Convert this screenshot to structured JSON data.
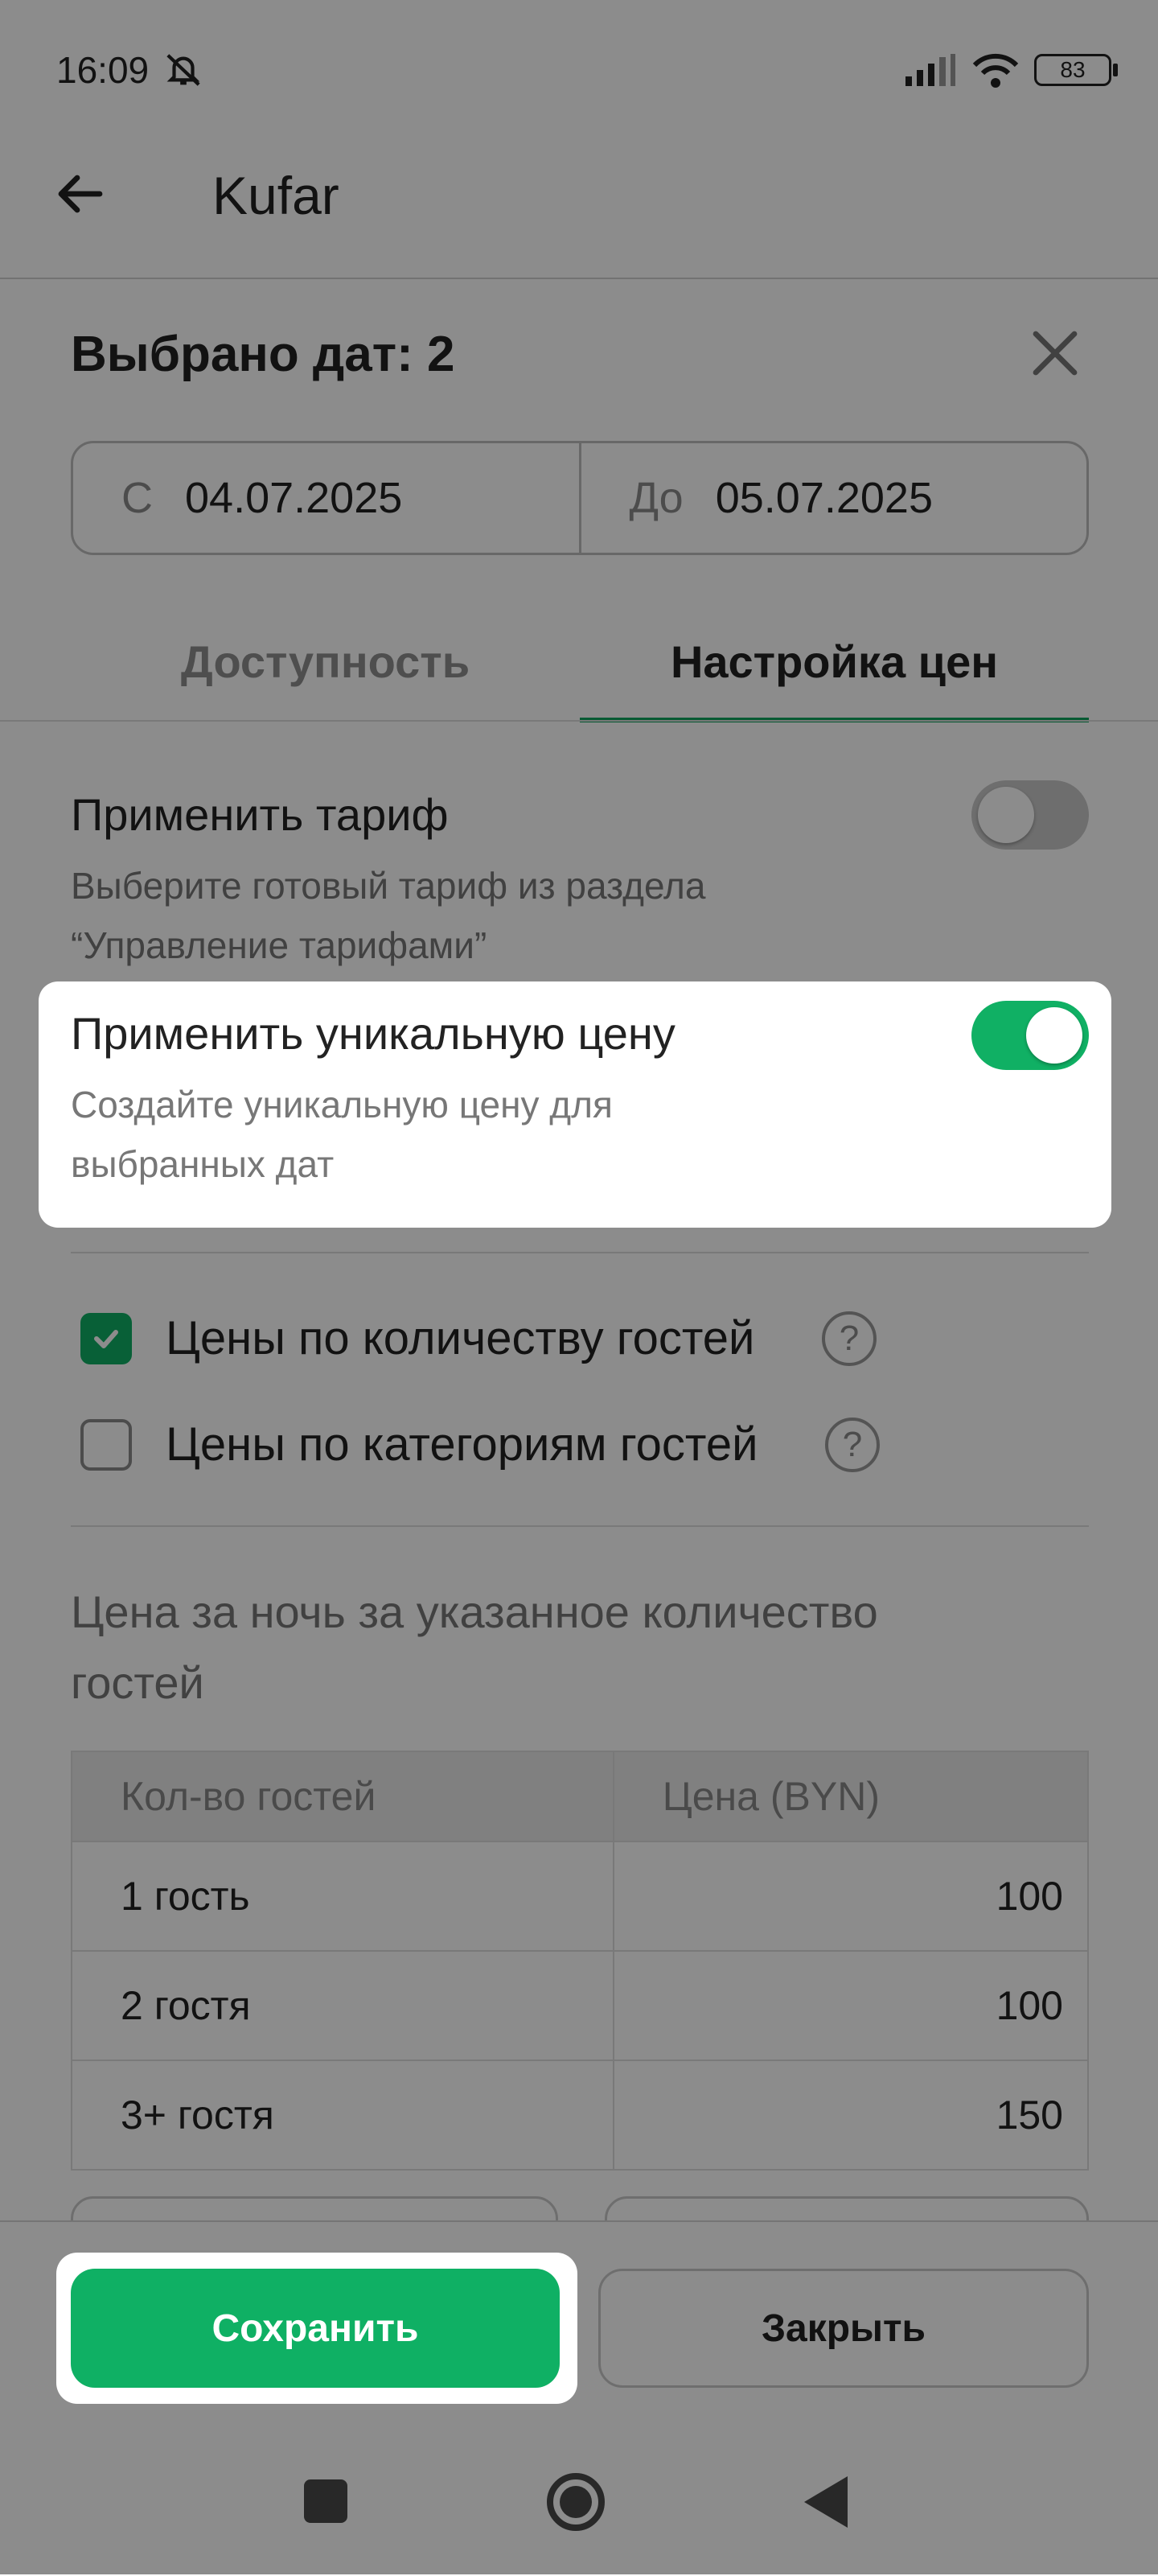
{
  "status_bar": {
    "time": "16:09",
    "battery": "83"
  },
  "header": {
    "title": "Kufar"
  },
  "sheet": {
    "title": "Выбрано дат: 2",
    "date_from_prefix": "С",
    "date_from": "04.07.2025",
    "date_to_prefix": "До",
    "date_to": "05.07.2025"
  },
  "tabs": [
    {
      "label": "Доступность",
      "active": false
    },
    {
      "label": "Настройка цен",
      "active": true
    }
  ],
  "options": {
    "tariff": {
      "title": "Применить тариф",
      "desc_line1": "Выберите готовый тариф из раздела",
      "desc_line2": "“Управление тарифами”",
      "enabled": false
    },
    "unique_price": {
      "title": "Применить уникальную цену",
      "desc_line1": "Создайте уникальную цену для",
      "desc_line2": "выбранных дат",
      "enabled": true
    }
  },
  "checkboxes": [
    {
      "label": "Цены по количеству гостей",
      "checked": true
    },
    {
      "label": "Цены по категориям гостей",
      "checked": false
    }
  ],
  "price_caption": "Цена за ночь за указанное количество гостей",
  "price_table": {
    "headers": [
      "Кол-во гостей",
      "Цена (BYN)"
    ],
    "rows": [
      {
        "guests": "1 гость",
        "price": "100"
      },
      {
        "guests": "2 гостя",
        "price": "100"
      },
      {
        "guests": "3+ гостя",
        "price": "150"
      }
    ]
  },
  "buttons": {
    "save": "Сохранить",
    "close": "Закрыть"
  },
  "colors": {
    "accent": "#0fb064",
    "text": "#222222",
    "muted": "#777777"
  }
}
